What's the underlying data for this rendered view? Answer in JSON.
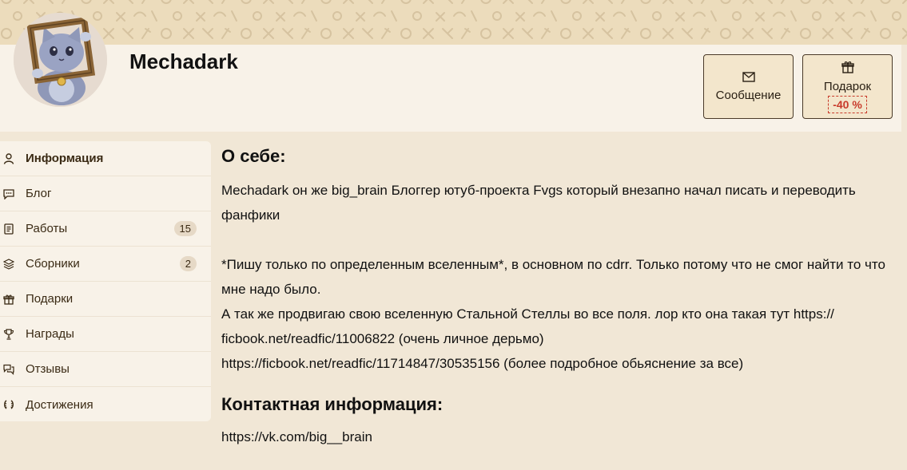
{
  "profile": {
    "username": "Mechadark",
    "avatar_icon": "cat-with-frame-avatar"
  },
  "actions": {
    "message_label": "Сообщение",
    "message_icon": "envelope-icon",
    "gift_label": "Подарок",
    "gift_icon": "gift-icon",
    "gift_discount": "-40 %"
  },
  "sidebar": {
    "items": [
      {
        "label": "Информация",
        "icon": "user-icon",
        "active": true,
        "count": ""
      },
      {
        "label": "Блог",
        "icon": "chat-icon",
        "active": false,
        "count": ""
      },
      {
        "label": "Работы",
        "icon": "document-icon",
        "active": false,
        "count": "15"
      },
      {
        "label": "Сборники",
        "icon": "layers-icon",
        "active": false,
        "count": "2"
      },
      {
        "label": "Подарки",
        "icon": "gift-icon",
        "active": false,
        "count": ""
      },
      {
        "label": "Награды",
        "icon": "trophy-icon",
        "active": false,
        "count": ""
      },
      {
        "label": "Отзывы",
        "icon": "reviews-icon",
        "active": false,
        "count": ""
      },
      {
        "label": "Достижения",
        "icon": "laurel-icon",
        "active": false,
        "count": ""
      }
    ]
  },
  "about": {
    "heading": "О себе:",
    "text": "Mechadark он же big_brain Блоггер ютуб-проекта Fvgs который внезапно начал писать и переводить фанфики\n\n*Пишу только по определенным вселенным*, в основном по cdrr. Только потому что не смог найти то что мне надо было.\nА так же продвигаю свою вселенную Стальной Стеллы во все поля. лор кто она такая тут https://\nficbook.net/readfic/11006822 (очень личное дерьмо)\nhttps://ficbook.net/readfic/11714847/30535156 (более подробное обьяснение за все)"
  },
  "contact": {
    "heading": "Контактная информация:",
    "value": "https://vk.com/big__brain"
  },
  "colors": {
    "background": "#f1e7d6",
    "card": "#f8f2e8",
    "banner": "#ecdcbc",
    "discount": "#c83a2a"
  }
}
